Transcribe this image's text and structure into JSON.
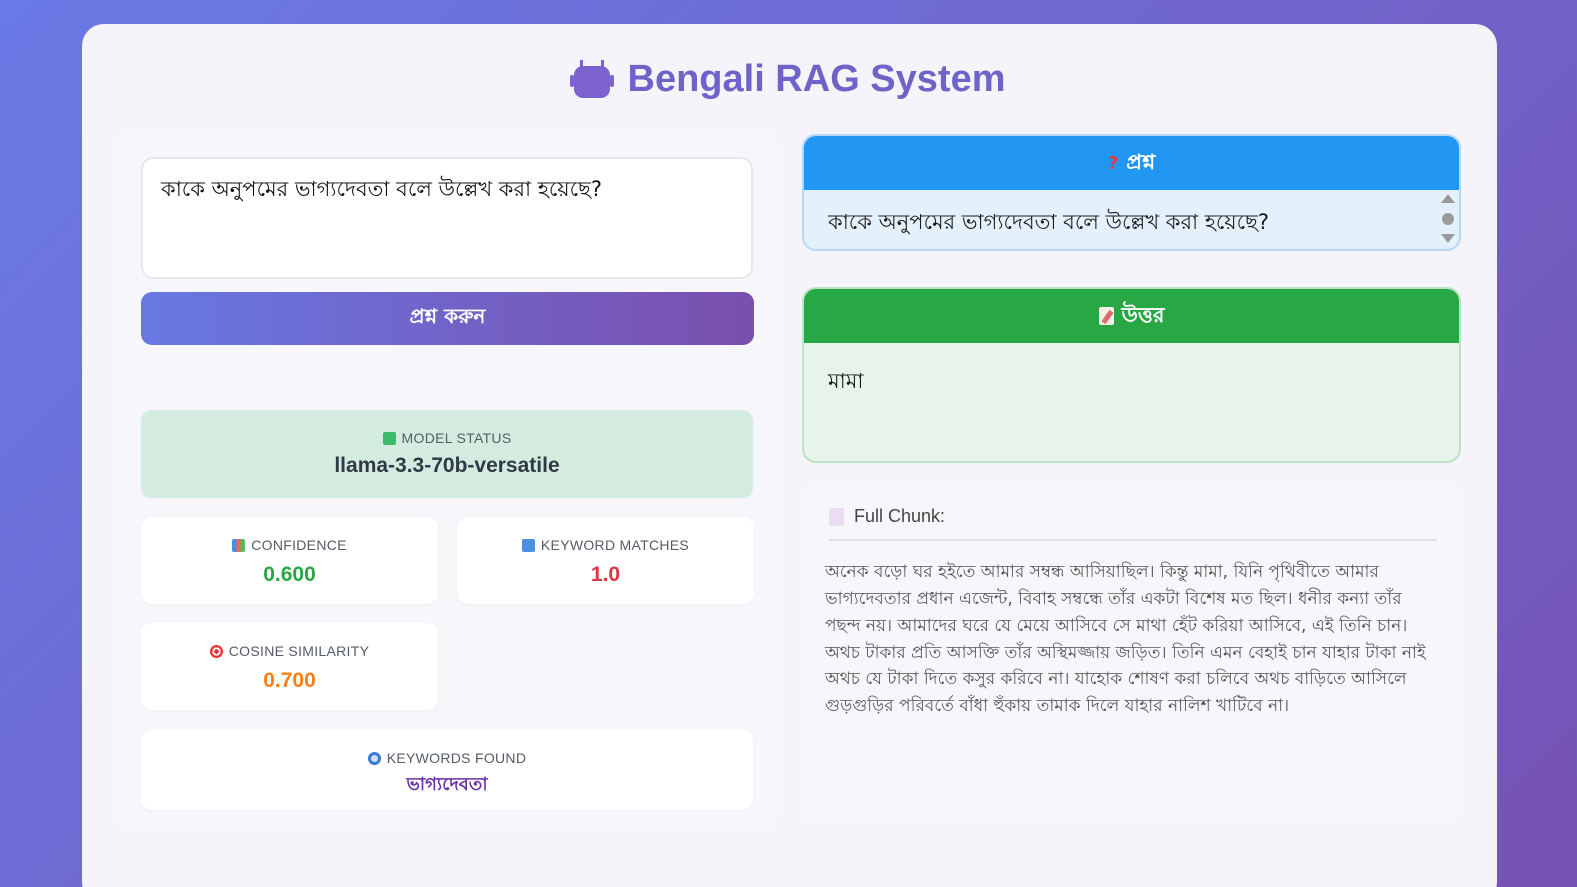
{
  "header": {
    "title": "Bengali RAG System",
    "icon": "robot-icon"
  },
  "query": {
    "value": "কাকে অনুপমের ভাগ্যদেবতা বলে উল্লেখ করা হয়েছে?",
    "placeholder": "",
    "submit_label": "প্রশ্ন করুন"
  },
  "stats": {
    "model_status": {
      "label": "MODEL STATUS",
      "value": "llama-3.3-70b-versatile",
      "icon": "check-icon"
    },
    "confidence": {
      "label": "CONFIDENCE",
      "value": "0.600",
      "icon": "bar-chart-icon",
      "color": "#28a745"
    },
    "keyword_matches": {
      "label": "KEYWORD MATCHES",
      "value": "1.0",
      "icon": "numbers-icon",
      "color": "#dc3545"
    },
    "cosine_similarity": {
      "label": "COSINE SIMILARITY",
      "value": "0.700",
      "icon": "target-icon",
      "color": "#fd7e14"
    },
    "keywords_found": {
      "label": "KEYWORDS FOUND",
      "value": "ভাগ্যদেবতা",
      "icon": "search-icon",
      "color": "#6f32a8"
    }
  },
  "question_panel": {
    "header": "প্রশ্ন",
    "icon": "question-icon",
    "text": "কাকে অনুপমের ভাগ্যদেবতা বলে উল্লেখ করা হয়েছে?"
  },
  "answer_panel": {
    "header": "উত্তর",
    "icon": "memo-icon",
    "text": "মামা"
  },
  "chunk": {
    "header": "Full Chunk:",
    "icon": "document-icon",
    "text": "অনেক বড়ো ঘর হইতে আমার সম্বন্ধ আসিয়াছিল। কিন্তু মামা, যিনি পৃথিবীতে আমার ভাগ্যদেবতার প্রধান এজেন্ট, বিবাহ সম্বন্ধে তাঁর একটা বিশেষ মত ছিল। ধনীর কন্যা তাঁর পছন্দ নয়। আমাদের ঘরে যে মেয়ে আসিবে সে মাথা হেঁট করিয়া আসিবে, এই তিনি চান। অথচ টাকার প্রতি আসক্তি তাঁর অস্থিমজ্জায় জড়িত। তিনি এমন বেহাই চান যাহার টাকা নাই অথচ যে টাকা দিতে কসুর করিবে না। যাহোক শোষণ করা চলিবে অথচ বাড়িতে আসিলে গুড়গুড়ির পরিবর্তে বাঁধা হুঁকায় তামাক দিলে যাহার নালিশ খাটিবে না।"
  },
  "colors": {
    "accent": "#6f63c9",
    "question_header": "#2196f3",
    "answer_header": "#28a745"
  }
}
